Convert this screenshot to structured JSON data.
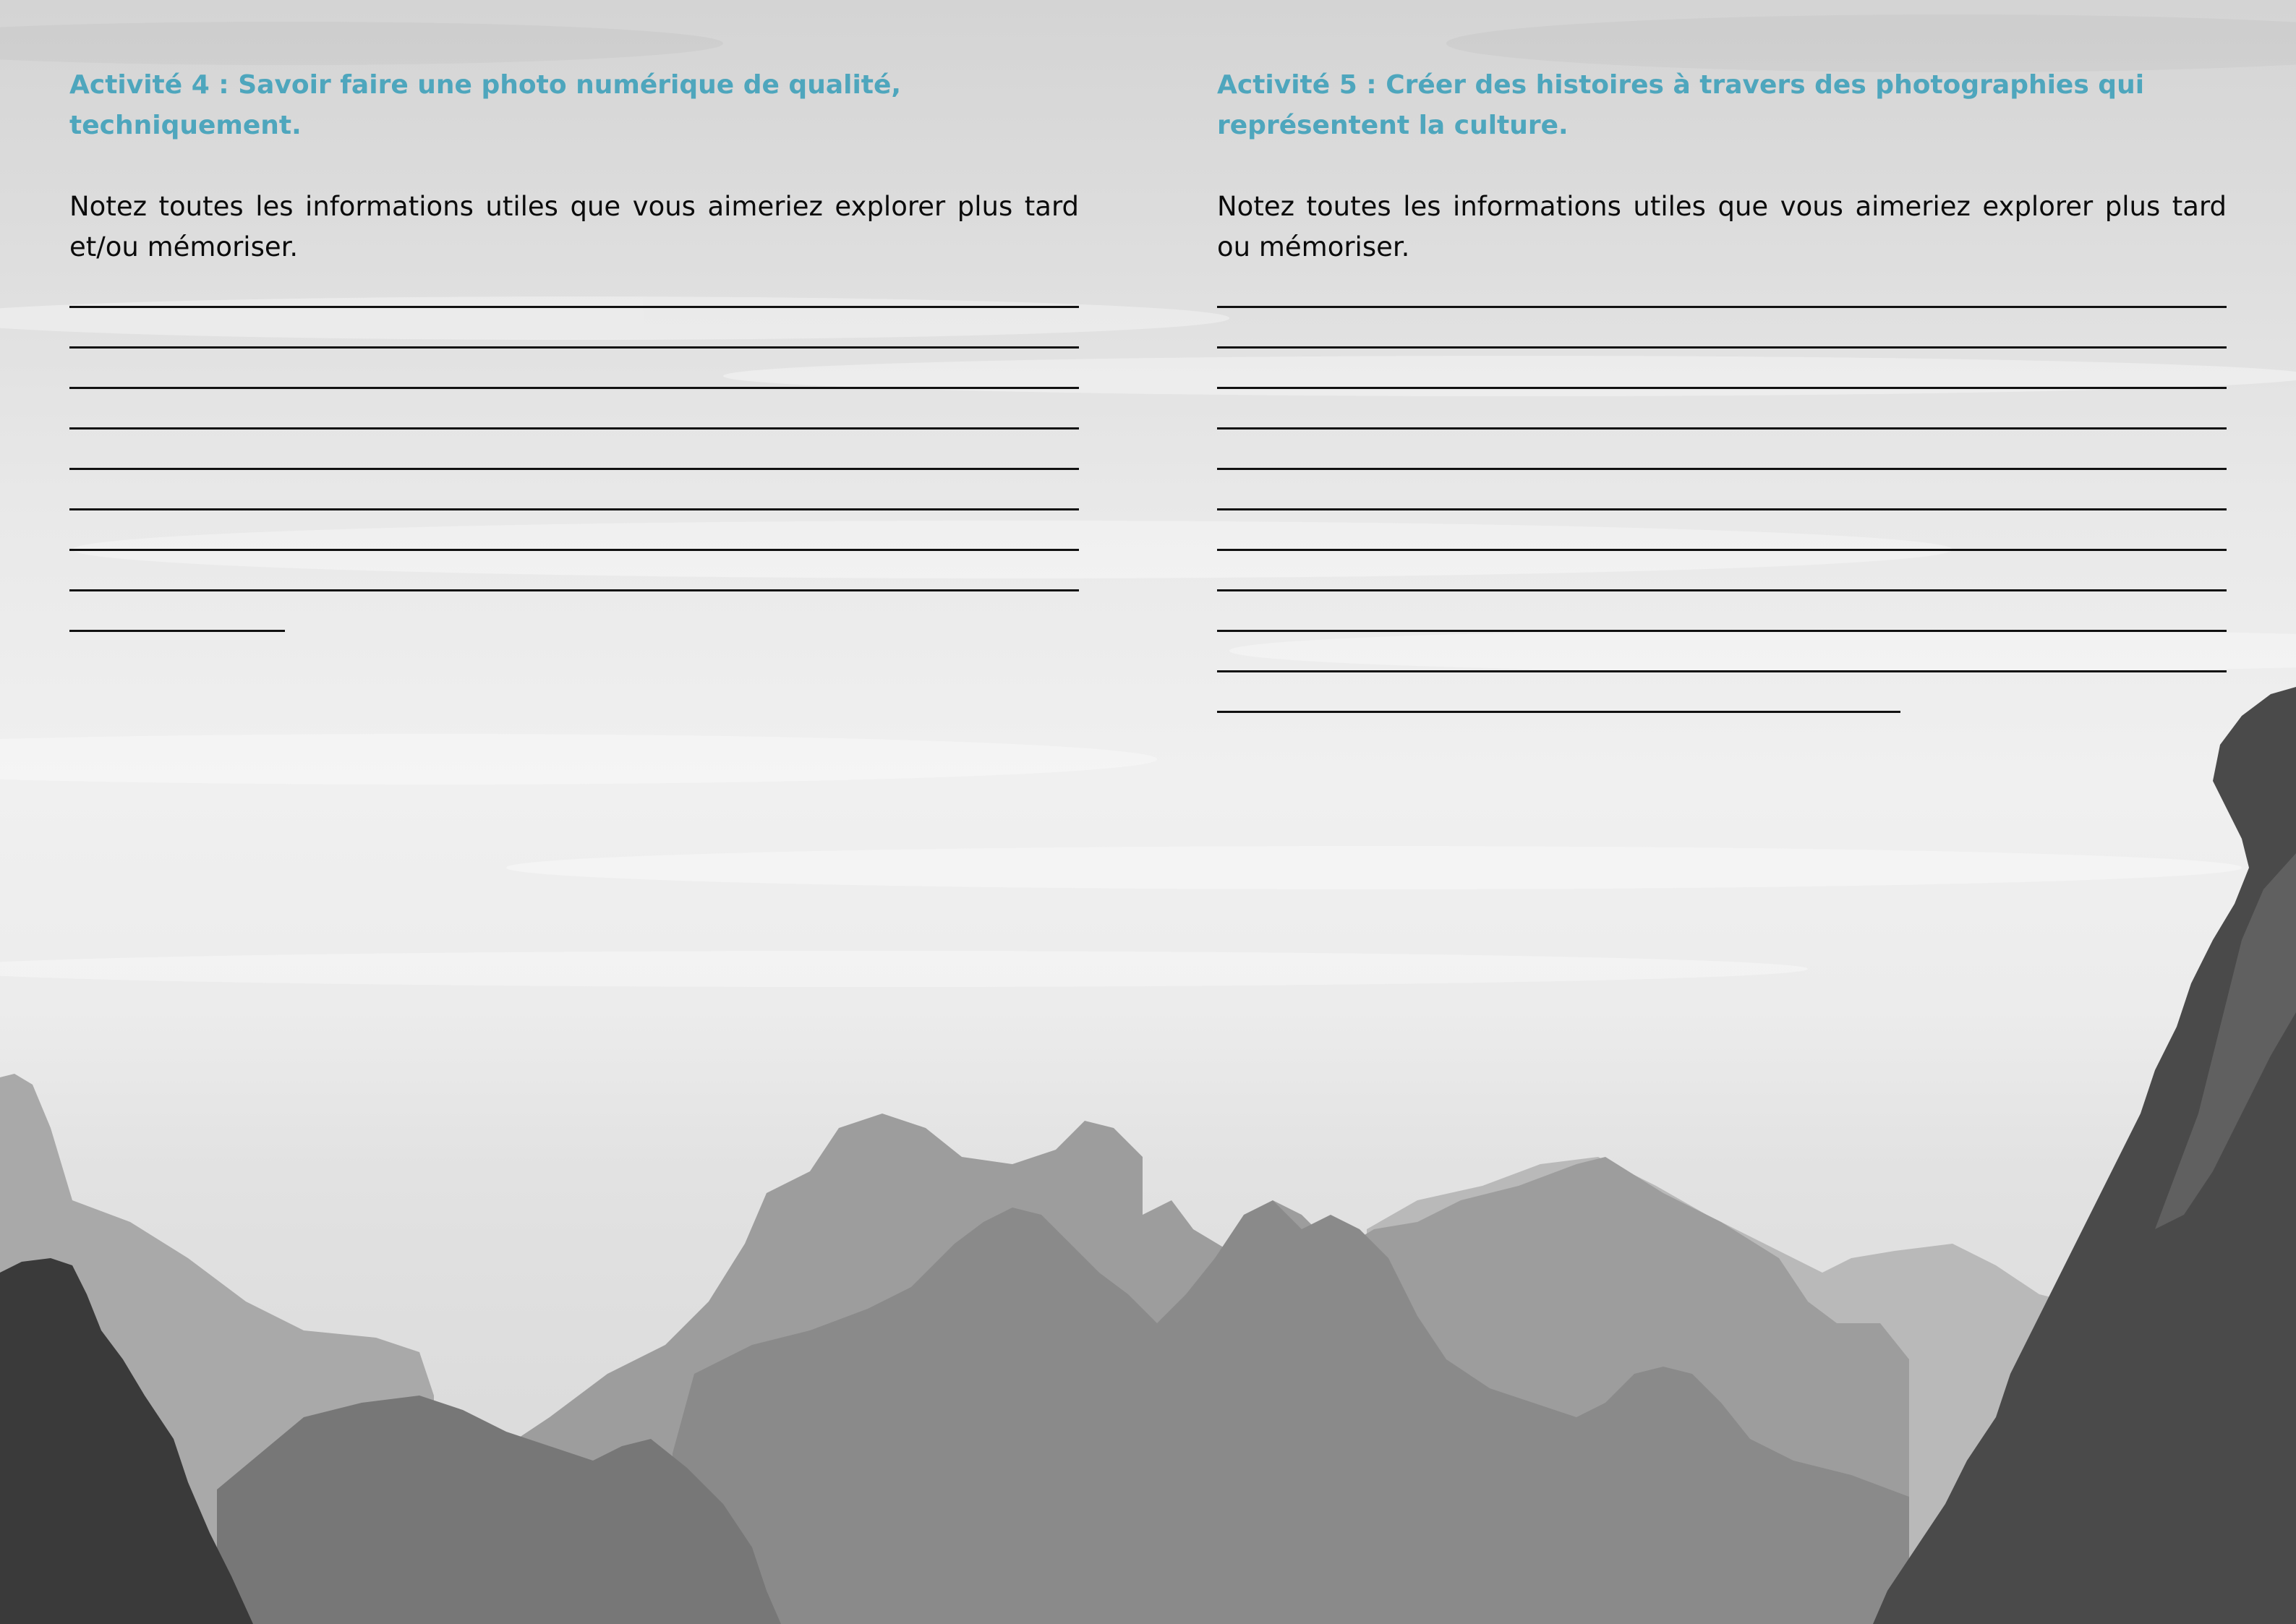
{
  "activities": [
    {
      "title": "Activité 4 : Savoir faire une photo numérique de qualité, techniquement.",
      "instruction": "Notez toutes les informations utiles que vous aimeriez explorer plus tard et/ou mémoriser.",
      "full_lines": 8,
      "has_partial_line": true
    },
    {
      "title": "Activité 5 : Créer des histoires à travers des photographies qui représentent la culture.",
      "instruction": "Notez toutes les informations utiles que vous aimeriez explorer plus tard ou mémoriser.",
      "full_lines": 10,
      "has_partial_line": true
    }
  ],
  "colors": {
    "title": "#4ea6bd",
    "body_text": "#0b0b0b",
    "rule_line": "#111111"
  },
  "background": "grayscale-mountain-landscape"
}
